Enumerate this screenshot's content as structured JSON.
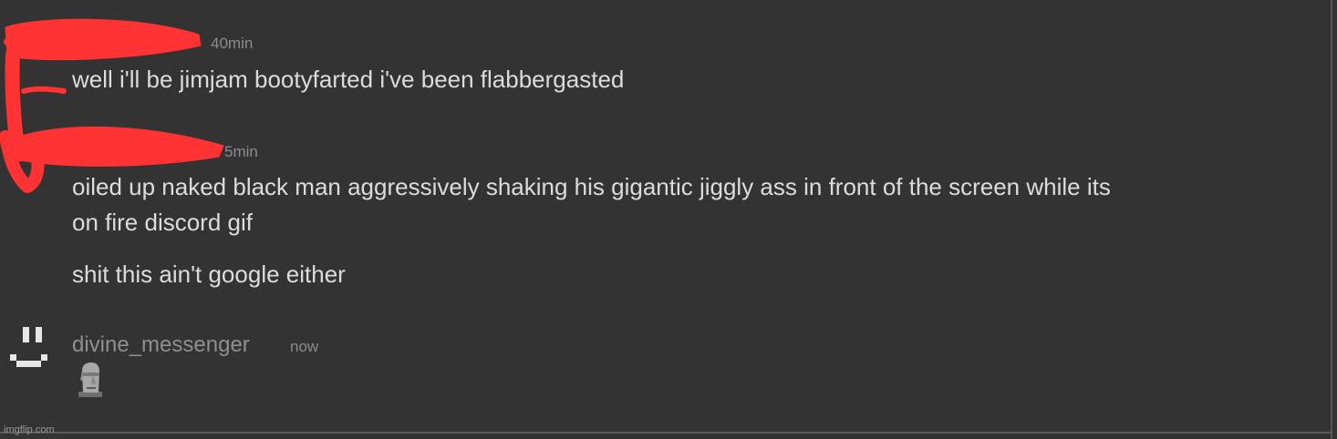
{
  "messages": {
    "group1": {
      "timestamp_1": "40min",
      "text_1": "well i'll be jimjam bootyfarted i've been flabbergasted",
      "timestamp_2": "5min",
      "text_2_line1": "oiled up naked black man aggressively shaking his gigantic jiggly ass in front of the screen while its",
      "text_2_line2": "on fire discord gif",
      "text_3": "shit this ain't google either"
    },
    "group2": {
      "username": "divine_messenger",
      "timestamp": "now",
      "emoji_name": "moai-emoji"
    }
  },
  "icons": {
    "avatar": "smiley-face-pixel-icon",
    "emoji": "moai-emoji"
  },
  "colors": {
    "background": "#333333",
    "message_text": "#dcdcdc",
    "meta_text": "#8c8c8c",
    "redaction": "#ff3333"
  },
  "watermark": "imgflip.com"
}
